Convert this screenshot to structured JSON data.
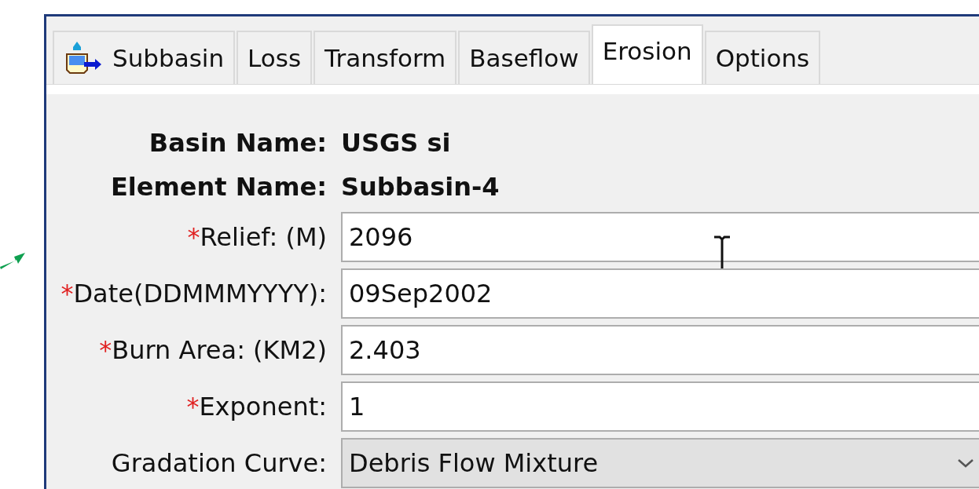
{
  "tabs": [
    {
      "label": "Subbasin",
      "selected": false
    },
    {
      "label": "Loss",
      "selected": false
    },
    {
      "label": "Transform",
      "selected": false
    },
    {
      "label": "Baseflow",
      "selected": false
    },
    {
      "label": "Erosion",
      "selected": true
    },
    {
      "label": "Options",
      "selected": false
    }
  ],
  "info": [
    {
      "label": "Basin Name:",
      "value": "USGS si"
    },
    {
      "label": "Element Name:",
      "value": "Subbasin-4"
    }
  ],
  "fields": [
    {
      "mark": "*",
      "label": "Relief: (M)",
      "kind": "text",
      "value": "2096"
    },
    {
      "mark": "*",
      "label": "Date(DDMMMYYYY):",
      "kind": "text",
      "value": "09Sep2002"
    },
    {
      "mark": "*",
      "label": "Burn Area: (KM2)",
      "kind": "text",
      "value": "2.403"
    },
    {
      "mark": "*",
      "label": "Exponent:",
      "kind": "text",
      "value": "1"
    },
    {
      "label": "Gradation Curve:",
      "kind": "combo",
      "value": "Debris Flow Mixture"
    }
  ]
}
